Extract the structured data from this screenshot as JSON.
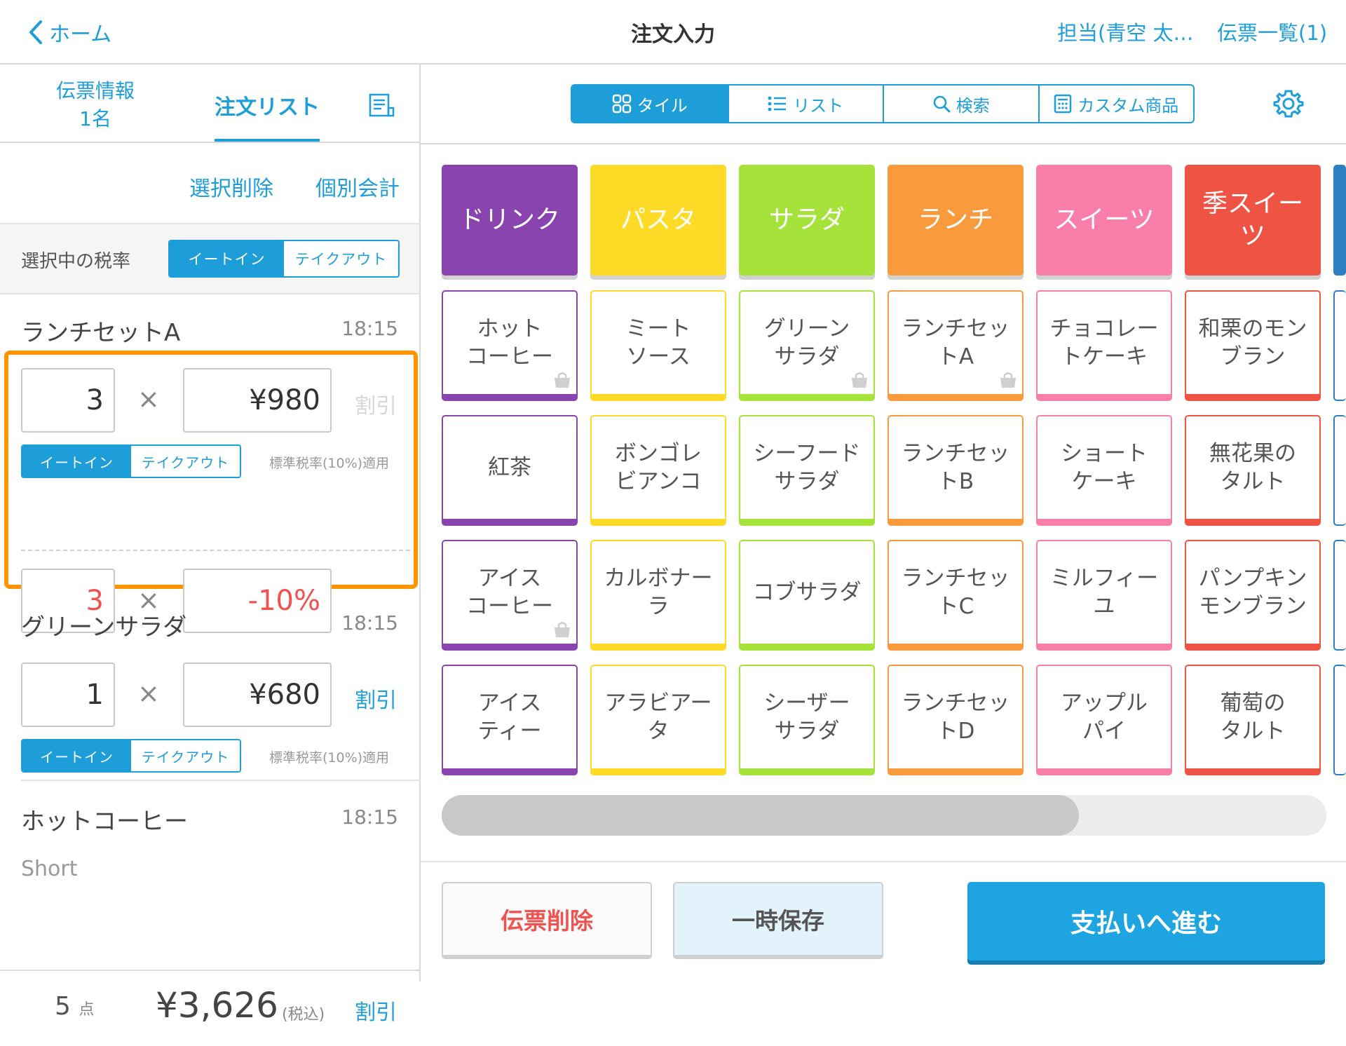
{
  "header": {
    "back_label": "ホーム",
    "title": "注文入力",
    "staff": "担当(青空 太…",
    "slip_list": "伝票一覧(1)"
  },
  "left": {
    "tab_info_line1": "伝票情報",
    "tab_info_line2": "1名",
    "tab_orders": "注文リスト",
    "select_delete": "選択削除",
    "split_pay": "個別会計",
    "tax_label": "選択中の税率",
    "eat_in": "イートイン",
    "takeout": "テイクアウト",
    "tax_note": "標準税率(10%)適用",
    "discount": "割引",
    "times": "×",
    "items": [
      {
        "name": "ランチセットA",
        "time": "18:15",
        "qty": "3",
        "price": "¥980",
        "discount_qty": "3",
        "discount_value": "-10%"
      },
      {
        "name": "グリーンサラダ",
        "time": "18:15",
        "qty": "1",
        "price": "¥680"
      },
      {
        "name": "ホットコーヒー",
        "time": "18:15",
        "option": "Short"
      }
    ],
    "footer": {
      "count": "5",
      "count_unit": "点",
      "total": "¥3,626",
      "tax_incl": "(税込)",
      "discount": "割引"
    }
  },
  "right": {
    "view_tabs": [
      "タイル",
      "リスト",
      "検索",
      "カスタム商品"
    ],
    "active_view": "タイル",
    "categories": [
      {
        "label": "ドリンク",
        "color": "#8944b0"
      },
      {
        "label": "パスタ",
        "color": "#fddb26"
      },
      {
        "label": "サラダ",
        "color": "#a5e23a"
      },
      {
        "label": "ランチ",
        "color": "#f99a3c"
      },
      {
        "label": "スイーツ",
        "color": "#f97eaa"
      },
      {
        "label": "季スイーツ",
        "color": "#ef5344"
      }
    ],
    "products": [
      [
        {
          "l1": "ホット",
          "l2": "コーヒー",
          "bag": true
        },
        {
          "l1": "ミート",
          "l2": "ソース"
        },
        {
          "l1": "グリーン",
          "l2": "サラダ",
          "bag": true
        },
        {
          "l1": "ランチセッ",
          "l2": "トA",
          "bag": true
        },
        {
          "l1": "チョコレー",
          "l2": "トケーキ"
        },
        {
          "l1": "和栗のモン",
          "l2": "ブラン"
        }
      ],
      [
        {
          "l1": "紅茶",
          "l2": ""
        },
        {
          "l1": "ボンゴレ",
          "l2": "ビアンコ"
        },
        {
          "l1": "シーフード",
          "l2": "サラダ"
        },
        {
          "l1": "ランチセッ",
          "l2": "トB"
        },
        {
          "l1": "ショート",
          "l2": "ケーキ"
        },
        {
          "l1": "無花果の",
          "l2": "タルト"
        }
      ],
      [
        {
          "l1": "アイス",
          "l2": "コーヒー",
          "bag": true
        },
        {
          "l1": "カルボナー",
          "l2": "ラ"
        },
        {
          "l1": "コブサラダ",
          "l2": ""
        },
        {
          "l1": "ランチセッ",
          "l2": "トC"
        },
        {
          "l1": "ミルフィー",
          "l2": "ユ"
        },
        {
          "l1": "パンプキン",
          "l2": "モンブラン"
        }
      ],
      [
        {
          "l1": "アイス",
          "l2": "ティー"
        },
        {
          "l1": "アラビアー",
          "l2": "タ"
        },
        {
          "l1": "シーザー",
          "l2": "サラダ"
        },
        {
          "l1": "ランチセッ",
          "l2": "トD"
        },
        {
          "l1": "アップル",
          "l2": "パイ"
        },
        {
          "l1": "葡萄の",
          "l2": "タルト"
        }
      ]
    ],
    "scroll_position": 0.72,
    "buttons": {
      "delete_slip": "伝票削除",
      "hold": "一時保存",
      "pay": "支払いへ進む"
    }
  }
}
